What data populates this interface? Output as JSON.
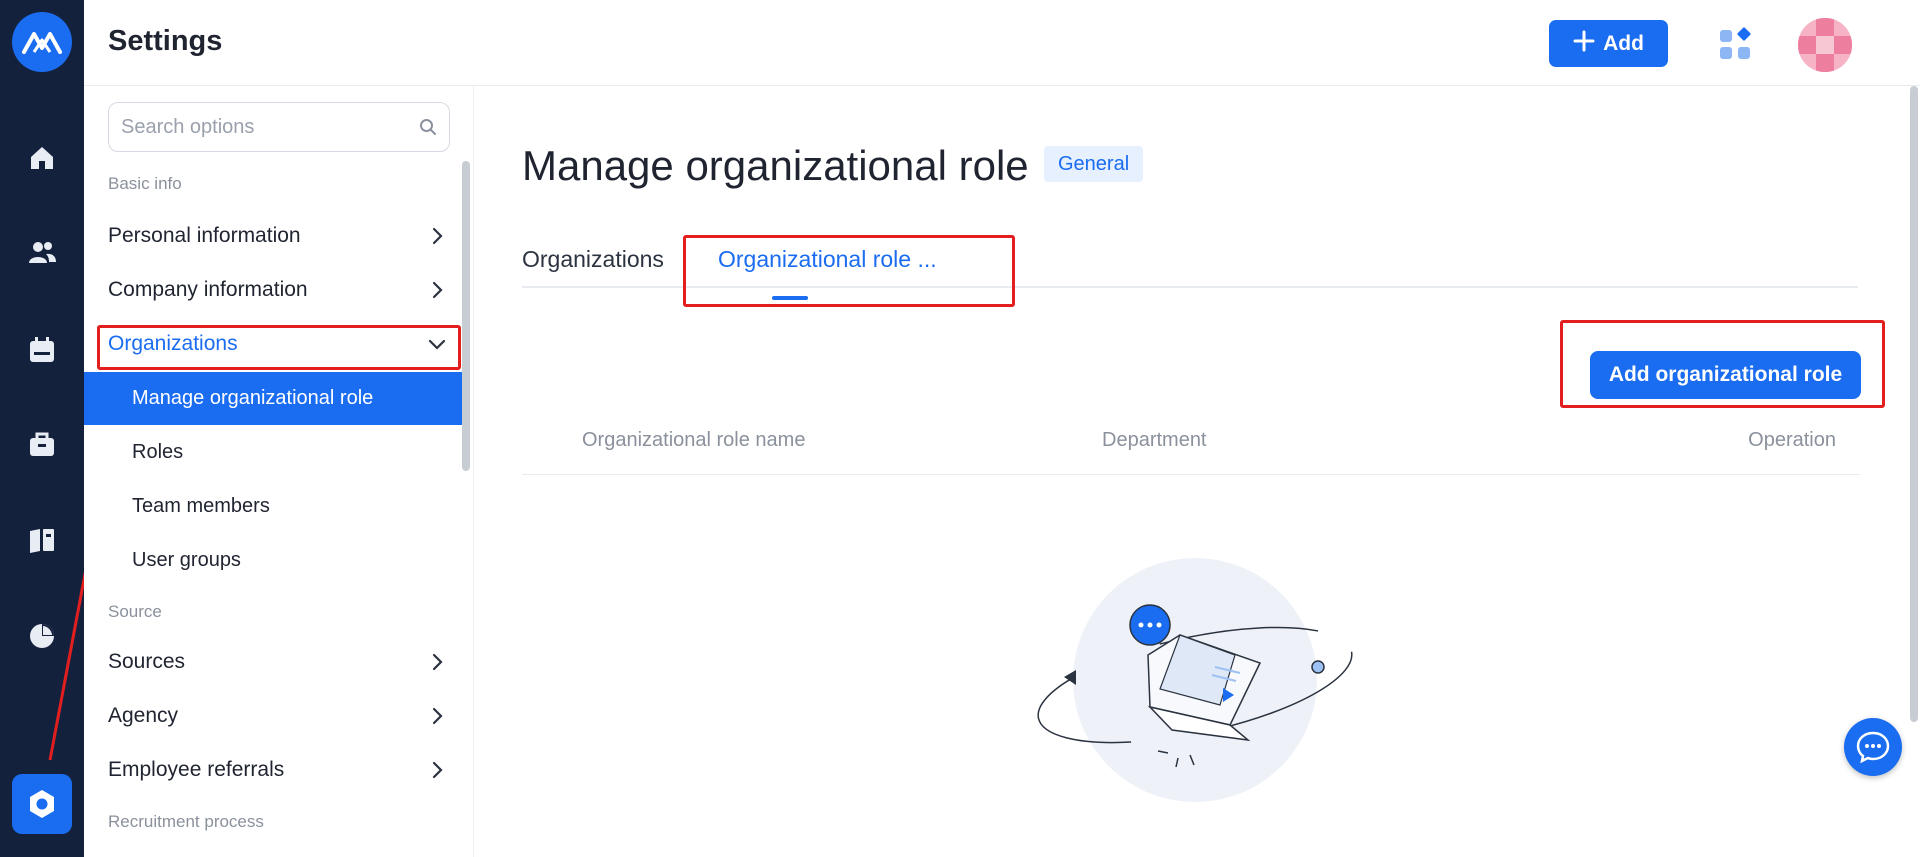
{
  "header": {
    "title": "Settings",
    "add_label": "Add"
  },
  "search": {
    "placeholder": "Search options"
  },
  "sidebar": {
    "sections": [
      {
        "label": "Basic info"
      },
      {
        "label": "Source"
      },
      {
        "label": "Recruitment process"
      }
    ],
    "items": [
      {
        "label": "Personal information"
      },
      {
        "label": "Company information"
      },
      {
        "label": "Organizations"
      },
      {
        "label": "Sources"
      },
      {
        "label": "Agency"
      },
      {
        "label": "Employee referrals"
      }
    ],
    "sub_items": [
      {
        "label": "Manage organizational role"
      },
      {
        "label": "Roles"
      },
      {
        "label": "Team members"
      },
      {
        "label": "User groups"
      }
    ]
  },
  "main": {
    "page_title": "Manage organizational role",
    "badge": "General",
    "tabs": [
      {
        "label": "Organizations"
      },
      {
        "label": "Organizational role ..."
      }
    ],
    "add_role_label": "Add organizational role",
    "table": {
      "columns": [
        "Organizational role name",
        "Department",
        "Operation"
      ]
    }
  },
  "colors": {
    "primary": "#1a6cf0",
    "rail": "#14213d",
    "annotation": "#e21e1e"
  },
  "icons": {
    "rail": [
      "logo-icon",
      "home-icon",
      "people-icon",
      "calendar-icon",
      "briefcase-icon",
      "book-icon",
      "pie-chart-icon",
      "settings-icon"
    ]
  }
}
